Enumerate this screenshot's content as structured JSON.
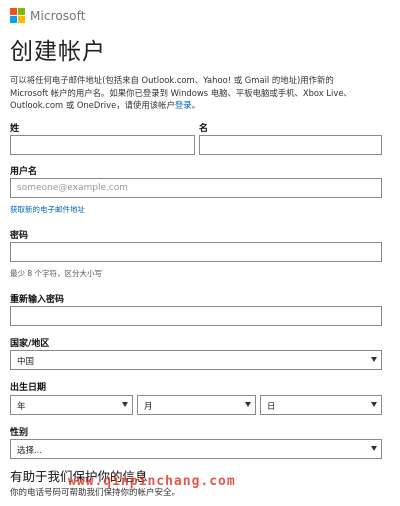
{
  "brand": {
    "name": "Microsoft",
    "colors": [
      "#f25022",
      "#7fba00",
      "#00a4ef",
      "#ffb900"
    ]
  },
  "page_title": "创建帐户",
  "intro": {
    "line1": "可以将任何电子邮件地址(包括来自 Outlook.com、Yahoo! 或 Gmail 的地址)用作新的",
    "line2": "Microsoft 帐户的用户名。如果你已登录到 Windows 电脑、平板电脑或手机、Xbox Live、",
    "line3_prefix": "Outlook.com 或 OneDrive，请使用该帐户",
    "signin_link": "登录",
    "line3_suffix": "。"
  },
  "form": {
    "last_name_label": "姓",
    "first_name_label": "名",
    "last_name_value": "",
    "first_name_value": "",
    "username_label": "用户名",
    "username_placeholder": "someone@example.com",
    "get_new_email_link": "获取新的电子邮件地址",
    "password_label": "密码",
    "password_hint": "最少 8 个字符，区分大小写",
    "reenter_password_label": "重新输入密码",
    "country_label": "国家/地区",
    "country_value": "中国",
    "birthdate_label": "出生日期",
    "year_value": "年",
    "month_value": "月",
    "day_value": "日",
    "gender_label": "性别",
    "gender_value": "选择..."
  },
  "protect": {
    "heading": "有助于我们保护你的信息",
    "description": "你的电话号码可帮助我们保持你的帐户安全。"
  },
  "watermark": "www.qinpinchang.com"
}
